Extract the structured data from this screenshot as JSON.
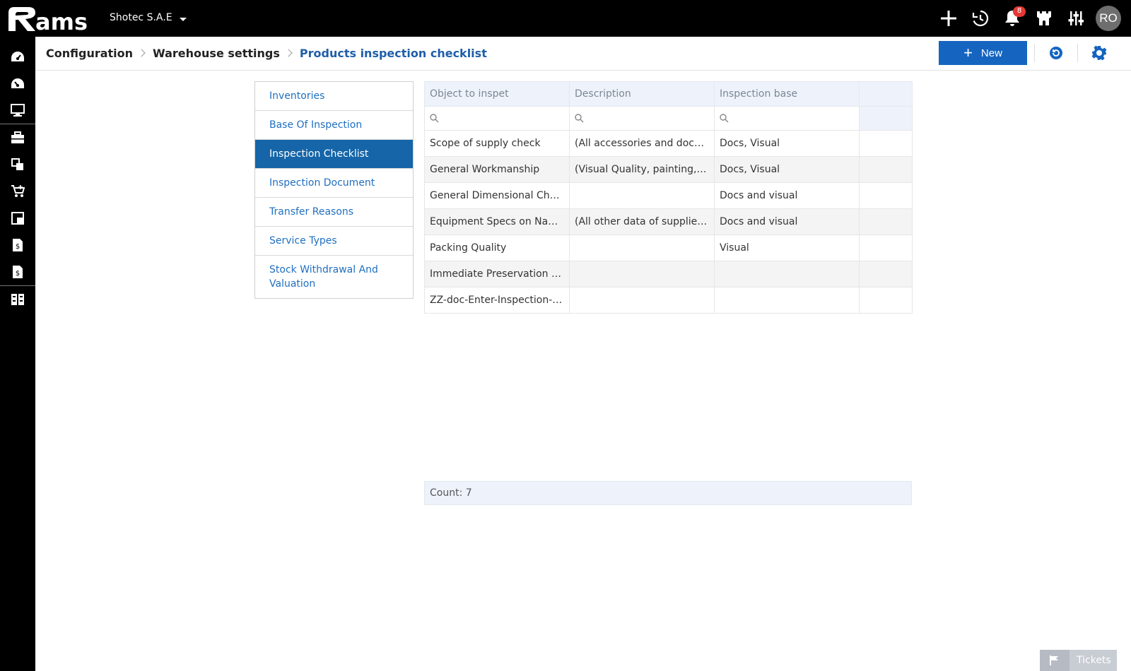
{
  "topbar": {
    "logo_text": "Rams",
    "company": "Shotec S.A.E",
    "notification_count": "8",
    "avatar_initials": "RO"
  },
  "breadcrumb": {
    "items": [
      "Configuration",
      "Warehouse settings"
    ],
    "current": "Products inspection checklist"
  },
  "toolbar": {
    "new_label": "New"
  },
  "menu": {
    "items": [
      "Inventories",
      "Base Of Inspection",
      "Inspection Checklist",
      "Inspection Document",
      "Transfer Reasons",
      "Service Types",
      "Stock Withdrawal And Valuation"
    ],
    "active": "Inspection Checklist"
  },
  "grid": {
    "columns": [
      "Object to inspet",
      "Description",
      "Inspection base",
      ""
    ],
    "rows": [
      [
        "Scope of supply check",
        "(All accessories and docu...",
        "Docs, Visual"
      ],
      [
        "General Workmanship",
        "(Visual Quality, painting, fr...",
        "Docs, Visual"
      ],
      [
        "General Dimensional Check",
        "",
        "Docs and visual"
      ],
      [
        "Equipment Specs on Nam...",
        "(All other data of supplier ...",
        "Docs and visual"
      ],
      [
        "Packing Quality",
        "",
        "Visual"
      ],
      [
        "Immediate Preservation A...",
        "",
        ""
      ],
      [
        "ZZ-doc-Enter-Inspection-c...",
        "",
        ""
      ]
    ],
    "count_label": "Count: 7"
  },
  "footer": {
    "tickets_label": "Tickets"
  },
  "colors": {
    "accent": "#1565c0",
    "topbar": "#000000",
    "badge": "#e53935",
    "header_bg": "#eef3fb"
  }
}
